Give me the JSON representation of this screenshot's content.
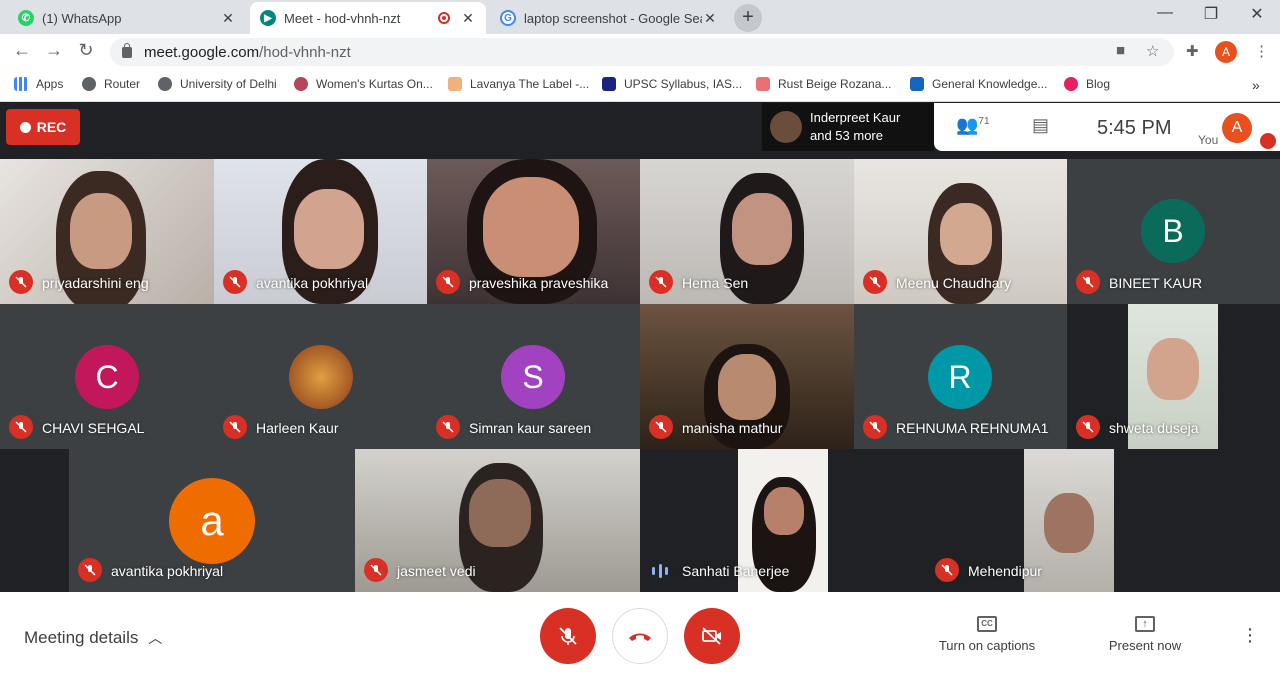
{
  "browser": {
    "tabs": [
      {
        "title": "(1) WhatsApp",
        "favicon": "whatsapp-icon"
      },
      {
        "title": "Meet - hod-vhnh-nzt",
        "favicon": "meet-icon"
      },
      {
        "title": "laptop screenshot - Google Search",
        "favicon": "google-icon"
      }
    ],
    "new_tab": "+",
    "url": {
      "domain": "meet.google.com",
      "path": "/hod-vhnh-nzt"
    },
    "profile_initial": "A",
    "bookmarks": [
      "Apps",
      "Router",
      "University of Delhi",
      "Women's Kurtas On...",
      "Lavanya The Label -...",
      "UPSC Syllabus, IAS...",
      "Rust Beige Rozana...",
      "General Knowledge...",
      "Blog"
    ],
    "more_bookmarks": "»"
  },
  "meet": {
    "rec_label": "REC",
    "presenter_line1": "Inderpreet Kaur",
    "presenter_line2": "and 53 more",
    "participants_count": "71",
    "time": "5:45 PM",
    "you_label": "You",
    "you_initial": "A",
    "tiles": [
      {
        "name": "priyadarshini eng",
        "avatar": null
      },
      {
        "name": "avantika pokhriyal",
        "avatar": null
      },
      {
        "name": "praveshika praveshika",
        "avatar": null
      },
      {
        "name": "Hema Sen",
        "avatar": null
      },
      {
        "name": "Meenu Chaudhary",
        "avatar": null
      },
      {
        "name": "BINEET KAUR",
        "avatar": "B",
        "color": "#0b6b5b"
      },
      {
        "name": "CHAVI SEHGAL",
        "avatar": "C",
        "color": "#c2185b"
      },
      {
        "name": "Harleen Kaur",
        "avatar": null
      },
      {
        "name": "Simran kaur sareen",
        "avatar": "S",
        "color": "#a142c1"
      },
      {
        "name": "manisha mathur",
        "avatar": null
      },
      {
        "name": "REHNUMA REHNUMA1",
        "avatar": "R",
        "color": "#0097a7"
      },
      {
        "name": "shweta duseja",
        "avatar": null
      },
      {
        "name": "avantika pokhriyal",
        "avatar": "a",
        "color": "#ef6c00"
      },
      {
        "name": "jasmeet vedi",
        "avatar": null
      },
      {
        "name": "Sanhati Banerjee",
        "avatar": null,
        "speaking": true
      },
      {
        "name": "Mehendipur",
        "avatar": null
      }
    ]
  },
  "bottom": {
    "meeting_details": "Meeting details",
    "captions": "Turn on captions",
    "captions_icon": "CC",
    "present": "Present now"
  },
  "colors": {
    "accent_red": "#d93025",
    "meet_bg": "#202124"
  }
}
